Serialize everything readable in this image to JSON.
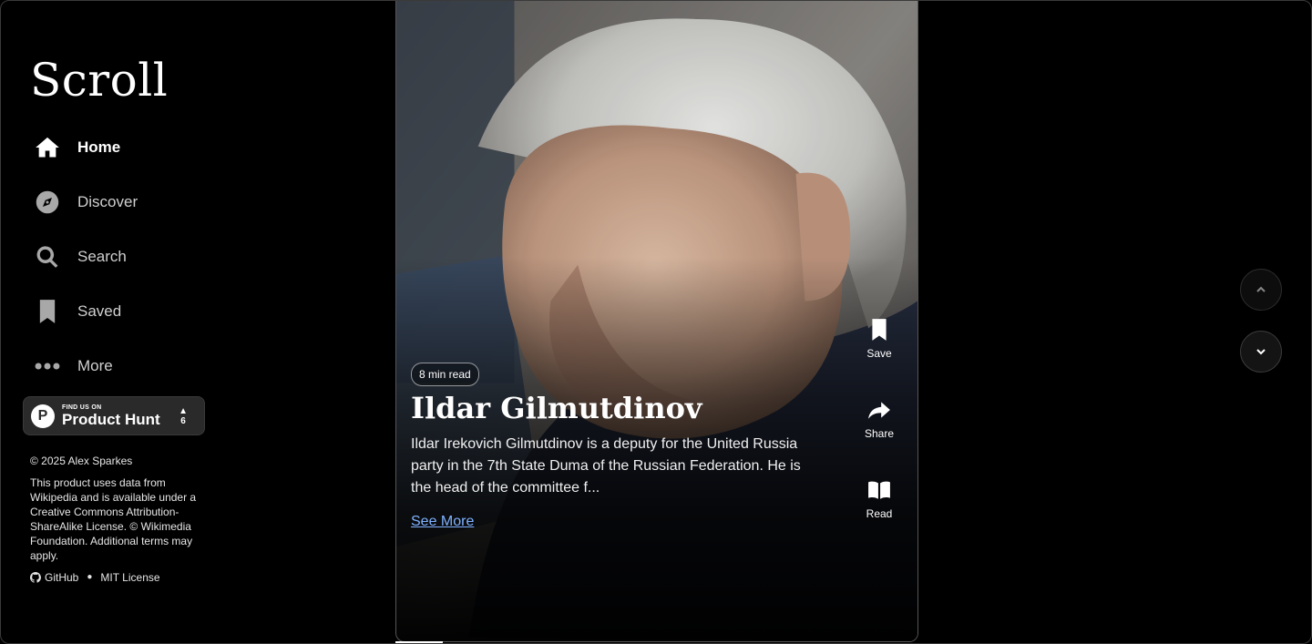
{
  "sidebar": {
    "logo": "Scroll",
    "items": [
      {
        "label": "Home",
        "icon": "home-icon"
      },
      {
        "label": "Discover",
        "icon": "compass-icon"
      },
      {
        "label": "Search",
        "icon": "search-icon"
      },
      {
        "label": "Saved",
        "icon": "bookmark-icon"
      },
      {
        "label": "More",
        "icon": "more-icon"
      }
    ],
    "product_hunt": {
      "small_text": "FIND US ON",
      "big_text": "Product Hunt",
      "votes": "6"
    },
    "footer": {
      "copyright": "© 2025 Alex Sparkes",
      "license_text": "This product uses data from Wikipedia and is available under a Creative Commons Attribution-ShareAlike License. © Wikimedia Foundation. Additional terms may apply.",
      "github_label": "GitHub",
      "mit_label": "MIT License"
    }
  },
  "card": {
    "read_time": "8 min read",
    "title": "Ildar Gilmutdinov",
    "summary": "Ildar Irekovich Gilmutdinov is a deputy for the United Russia party in the 7th State Duma of the Russian Federation. He is the head of the committee f...",
    "see_more": "See More",
    "actions": {
      "save": "Save",
      "share": "Share",
      "read": "Read"
    }
  },
  "colors": {
    "background": "#000000",
    "link": "#7fb2ff"
  }
}
